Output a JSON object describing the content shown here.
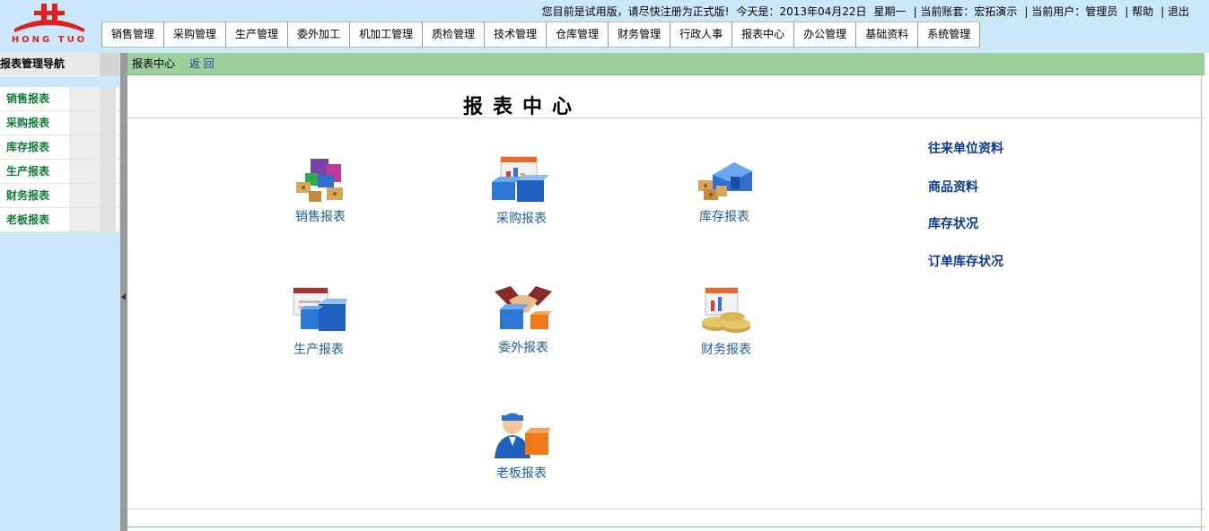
{
  "topinfo": {
    "trial_notice": "您目前是试用版，请尽快注册为正式版!",
    "today_label": "今天是：2013年04月22日",
    "weekday": "星期一",
    "account": "| 当前账套：宏拓演示",
    "user": "| 当前用户：管理员",
    "help": "| 帮助",
    "logout": "| 退出"
  },
  "logo": {
    "text": "HONG TUO",
    "color": "#e02020"
  },
  "menu": [
    "销售管理",
    "采购管理",
    "生产管理",
    "委外加工",
    "机加工管理",
    "质检管理",
    "技术管理",
    "仓库管理",
    "财务管理",
    "行政人事",
    "报表中心",
    "办公管理",
    "基础资料",
    "系统管理"
  ],
  "sidebar": {
    "title": "报表管理导航",
    "items": [
      "销售报表",
      "采购报表",
      "库存报表",
      "生产报表",
      "财务报表",
      "老板报表"
    ]
  },
  "breadcrumb": {
    "current": "报表中心",
    "back": "返 回"
  },
  "page_title": "报表中心",
  "reports": {
    "sales": {
      "label": "销售报表",
      "icon": "sales-boxes-icon"
    },
    "purchase": {
      "label": "采购报表",
      "icon": "purchase-chart-icon"
    },
    "inventory": {
      "label": "库存报表",
      "icon": "warehouse-icon"
    },
    "production": {
      "label": "生产报表",
      "icon": "production-boxes-icon"
    },
    "outsource": {
      "label": "委外报表",
      "icon": "handshake-icon"
    },
    "finance": {
      "label": "财务报表",
      "icon": "coins-icon"
    },
    "boss": {
      "label": "老板报表",
      "icon": "manager-icon"
    }
  },
  "quick_links": [
    "往来单位资料",
    "商品资料",
    "库存状况",
    "订单库存状况"
  ],
  "colors": {
    "accent_green": "#9ccf9c",
    "nav_text": "#117a3b",
    "link_blue": "#0b3a9a",
    "background": "#cbe8fb"
  }
}
